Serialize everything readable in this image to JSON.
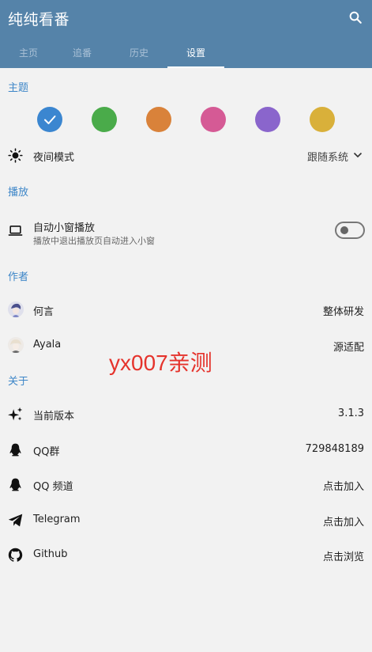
{
  "app": {
    "title": "纯纯看番"
  },
  "tabs": [
    {
      "label": "主页"
    },
    {
      "label": "追番"
    },
    {
      "label": "历史"
    },
    {
      "label": "设置"
    }
  ],
  "sections": {
    "theme": "主题",
    "playback": "播放",
    "author": "作者",
    "about": "关于"
  },
  "theme_colors": [
    "#3b86d0",
    "#4aab4a",
    "#d9823a",
    "#d55a95",
    "#8a65cc",
    "#d9b03a"
  ],
  "theme_selected_index": 0,
  "night_mode": {
    "label": "夜间模式",
    "value": "跟随系统"
  },
  "auto_pip": {
    "label": "自动小窗播放",
    "description": "播放中退出播放页自动进入小窗",
    "enabled": false
  },
  "authors": [
    {
      "name": "何言",
      "role": "整体研发"
    },
    {
      "name": "Ayala",
      "role": "源适配"
    }
  ],
  "watermark": "yx007亲测",
  "about": [
    {
      "icon": "sparkle-icon",
      "label": "当前版本",
      "value": "3.1.3"
    },
    {
      "icon": "qq-icon",
      "label": "QQ群",
      "value": "729848189"
    },
    {
      "icon": "qq-icon",
      "label": "QQ 频道",
      "value": "点击加入"
    },
    {
      "icon": "telegram-icon",
      "label": "Telegram",
      "value": "点击加入"
    },
    {
      "icon": "github-icon",
      "label": "Github",
      "value": "点击浏览"
    }
  ]
}
